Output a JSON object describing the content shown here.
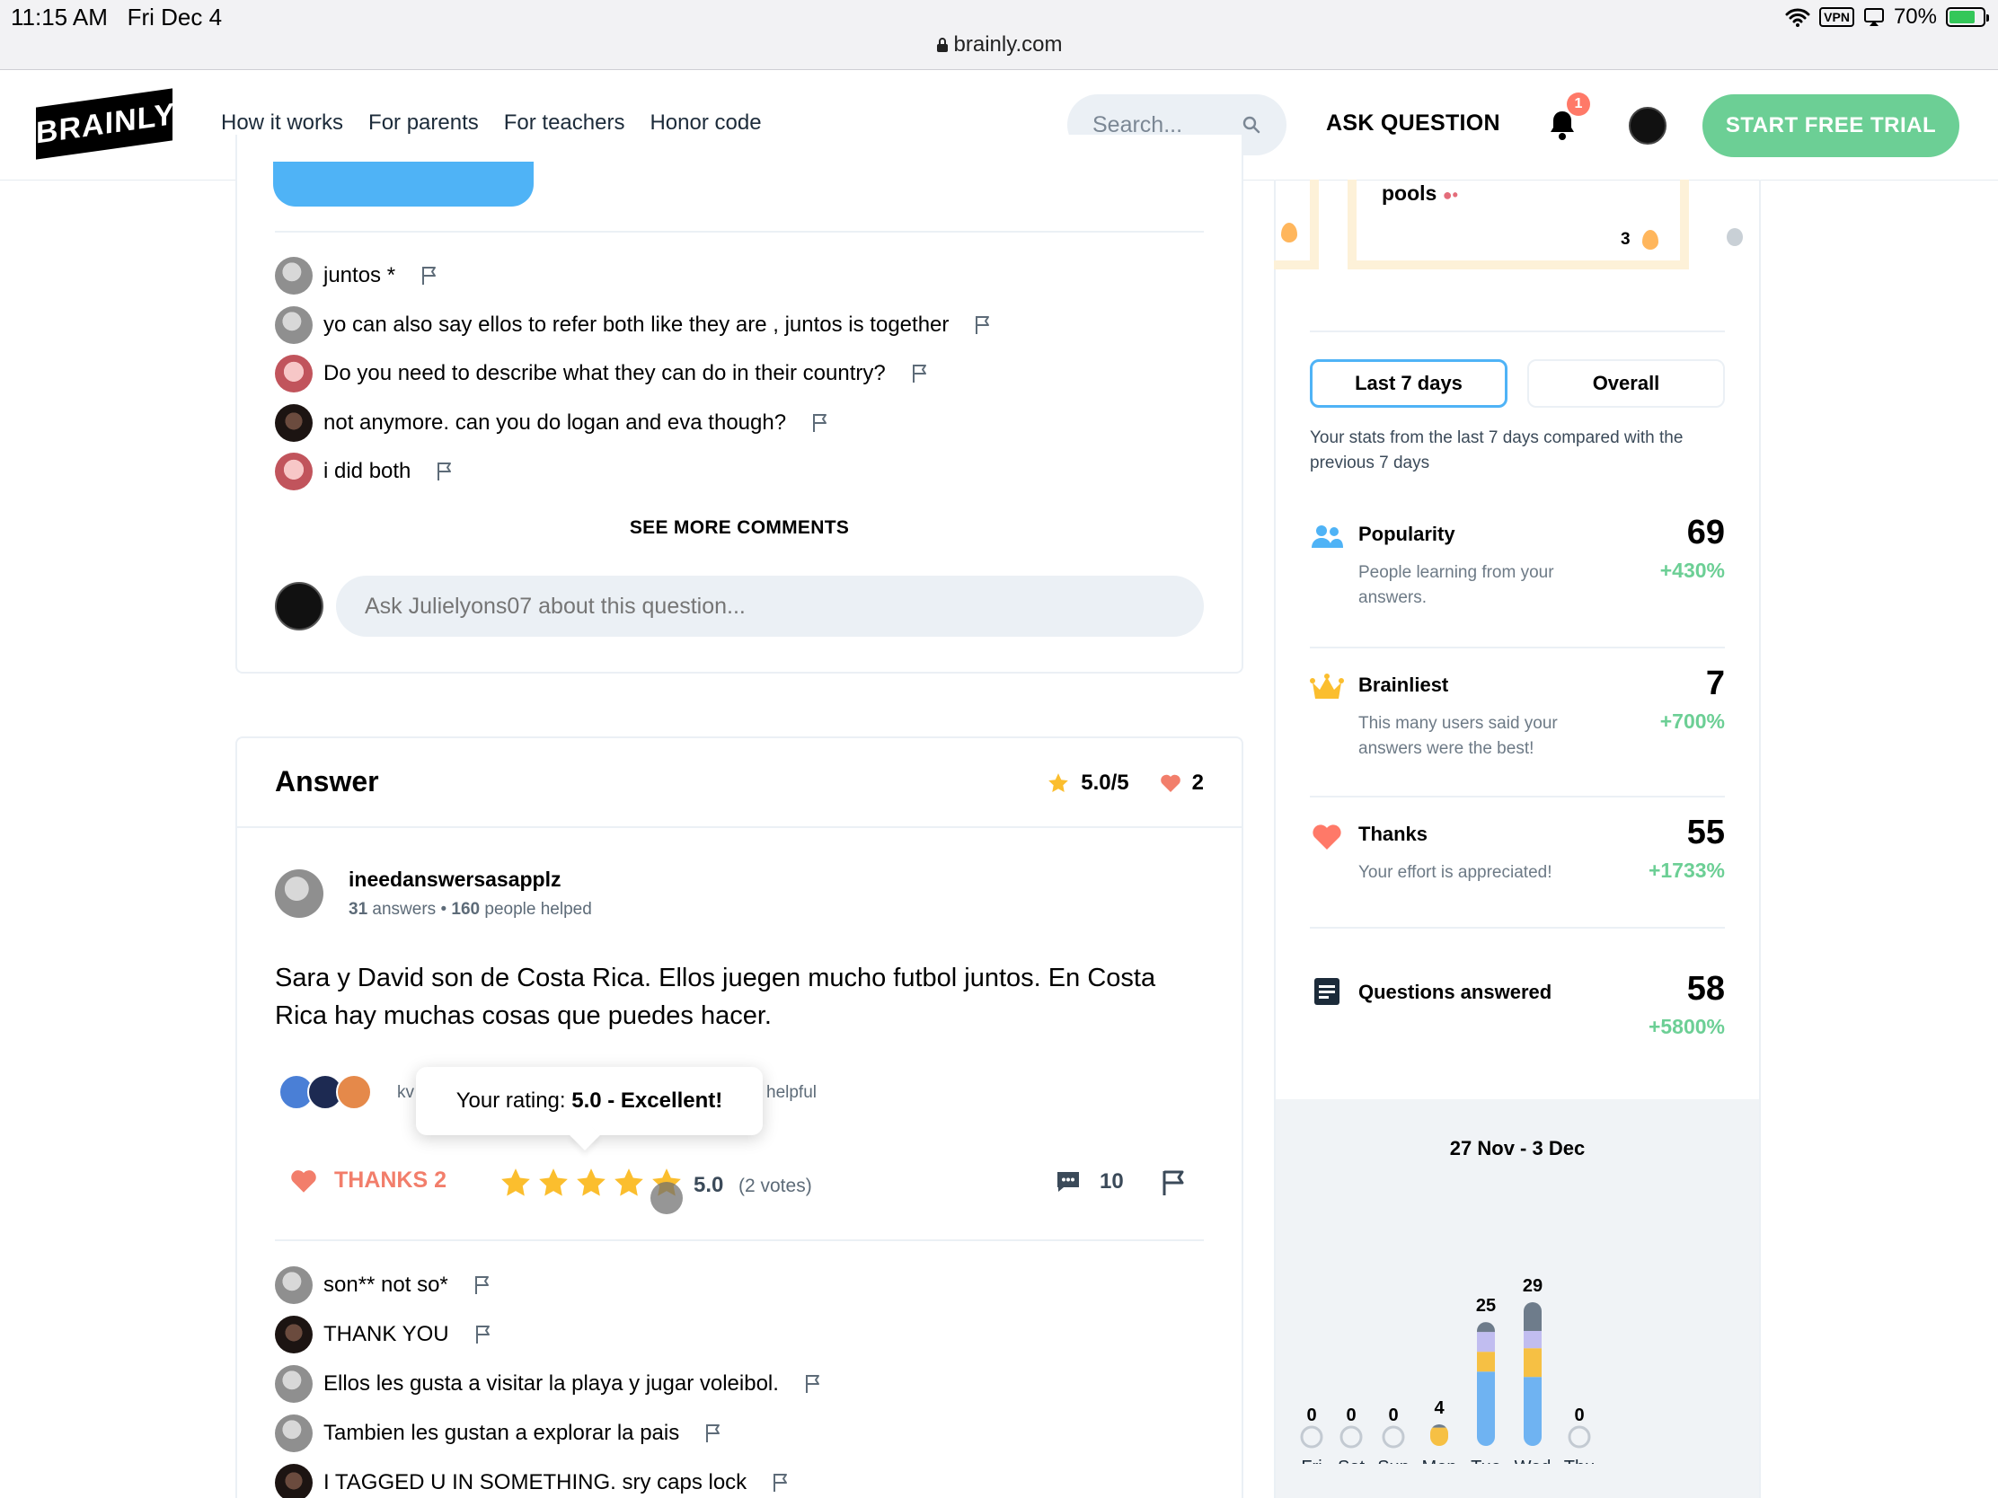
{
  "status_bar": {
    "time": "11:15 AM",
    "date": "Fri Dec 4",
    "url": "brainly.com",
    "vpn": "VPN",
    "battery": "70%"
  },
  "header": {
    "logo": "BRAINLY",
    "nav": [
      "How it works",
      "For parents",
      "For teachers",
      "Honor code"
    ],
    "search_placeholder": "Search...",
    "ask_question": "ASK QUESTION",
    "notification_count": "1",
    "trial_button": "START FREE TRIAL"
  },
  "question_comments": [
    {
      "text": "juntos *",
      "avatar": "grey"
    },
    {
      "text": "yo can also say ellos to refer both like they are , juntos is together",
      "avatar": "grey"
    },
    {
      "text": "Do you need to describe what they can do in their country?",
      "avatar": "pink"
    },
    {
      "text": "not anymore. can you do logan and eva though?",
      "avatar": "dark"
    },
    {
      "text": "i did both",
      "avatar": "pink"
    }
  ],
  "see_more": "SEE MORE COMMENTS",
  "ask_placeholder": "Ask Julielyons07 about this question...",
  "answer": {
    "title": "Answer",
    "rating": "5.0/5",
    "thanks_count": "2",
    "author": "ineedanswersasapplz",
    "answers_count": "31",
    "answers_label": "answers",
    "helped_count": "160",
    "helped_label": "people helped",
    "text": "Sara y David son de Costa Rica. Ellos juegen mucho futbol juntos. En Costa Rica hay muchas cosas que puedes hacer.",
    "helpers_prefix": "kv",
    "helpful_suffix": "helpful",
    "tooltip_prefix": "Your rating: ",
    "tooltip_value": "5.0 - Excellent!",
    "thanks_label": "THANKS 2",
    "stars": 5,
    "rating_value": "5.0",
    "votes": "(2 votes)",
    "comment_count": "10"
  },
  "answer_comments": [
    {
      "text": "son** not so*",
      "avatar": "grey"
    },
    {
      "text": "THANK YOU",
      "avatar": "dark"
    },
    {
      "text": "Ellos les gusta a visitar la playa y jugar voleibol.",
      "avatar": "grey"
    },
    {
      "text": "Tambien les gustan a explorar la pais",
      "avatar": "grey"
    },
    {
      "text": "I TAGGED U IN SOMETHING. sry caps lock",
      "avatar": "dark"
    }
  ],
  "league": {
    "name": "pools",
    "score": "3"
  },
  "stats_tabs": {
    "last7": "Last 7 days",
    "overall": "Overall"
  },
  "stats_desc": "Your stats from the last 7 days compared with the previous 7 days",
  "stats": [
    {
      "label": "Popularity",
      "sub": "People learning from your answers.",
      "value": "69",
      "change": "+430%",
      "icon": "people-icon"
    },
    {
      "label": "Brainliest",
      "sub": "This many users said your answers were the best!",
      "value": "7",
      "change": "+700%",
      "icon": "crown-icon"
    },
    {
      "label": "Thanks",
      "sub": "Your effort is appreciated!",
      "value": "55",
      "change": "+1733%",
      "icon": "heart-icon"
    },
    {
      "label": "Questions answered",
      "sub": "",
      "value": "58",
      "change": "+5800%",
      "icon": "list-icon"
    }
  ],
  "colors": {
    "accent_blue": "#4fb3f6",
    "green": "#6ccf95",
    "thanks_red": "#f27e6b",
    "star_yellow": "#fbbe2e",
    "bar_blue": "#6fb3f2",
    "bar_yellow": "#f6c044",
    "bar_lavender": "#c1bdf0",
    "bar_slate": "#6e7c8b"
  },
  "chart_data": {
    "type": "bar",
    "title": "27 Nov - 3 Dec",
    "categories": [
      "Fri",
      "Sat",
      "Sun",
      "Mon",
      "Tue",
      "Wed",
      "Thu"
    ],
    "values": [
      0,
      0,
      0,
      4,
      25,
      29,
      0
    ],
    "stacked_segments_fraction": {
      "Mon": [
        0.0,
        0.85,
        0.0,
        0.15
      ],
      "Tue": [
        0.6,
        0.16,
        0.16,
        0.08
      ],
      "Wed": [
        0.48,
        0.2,
        0.12,
        0.2
      ]
    },
    "segment_colors": [
      "#6fb3f2",
      "#f6c044",
      "#c1bdf0",
      "#6e7c8b"
    ],
    "ylim": [
      0,
      29
    ]
  }
}
